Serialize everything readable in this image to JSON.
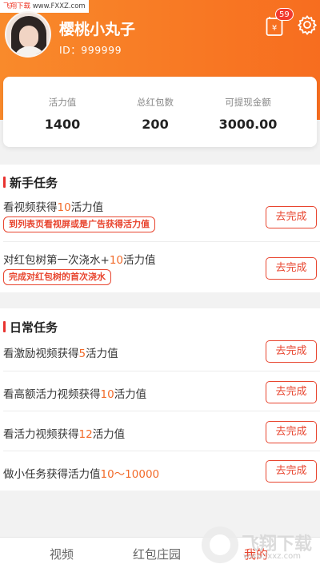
{
  "watermark": {
    "brand": "飞翔下载",
    "site": "www.FXXZ.com",
    "logo_text": "飞翔下载",
    "logo_url": "www.fxxz.com"
  },
  "profile": {
    "name": "樱桃小丸子",
    "id_label": "ID：999999"
  },
  "header": {
    "badge_count": "59"
  },
  "stats": [
    {
      "label": "活力值",
      "value": "1400"
    },
    {
      "label": "总红包数",
      "value": "200"
    },
    {
      "label": "可提现金额",
      "value": "3000.00"
    }
  ],
  "newbie": {
    "title": "新手任务",
    "tasks": [
      {
        "text_before": "看视频获得",
        "num": "10",
        "text_after": "活力值",
        "tag": "到列表页看视屏或是广告获得活力值",
        "button": "去完成"
      },
      {
        "text_before": "对红包树第一次浇水+",
        "num": "10",
        "text_after": "活力值",
        "tag": "完成对红包树的首次浇水",
        "button": "去完成"
      }
    ]
  },
  "daily": {
    "title": "日常任务",
    "tasks": [
      {
        "text_before": "看激励视频获得",
        "num": "5",
        "text_after": "活力值",
        "button": "去完成"
      },
      {
        "text_before": "看高额活力视频获得",
        "num": "10",
        "text_after": "活力值",
        "button": "去完成"
      },
      {
        "text_before": "看活力视频获得",
        "num": "12",
        "text_after": "活力值",
        "button": "去完成"
      },
      {
        "text_before": "做小任务获得活力值",
        "num": "10～10000",
        "text_after": "",
        "button": "去完成"
      }
    ]
  },
  "tabs": [
    {
      "label": "视频",
      "active": false
    },
    {
      "label": "红包庄园",
      "active": false
    },
    {
      "label": "我的",
      "active": true
    }
  ],
  "colors": {
    "accent": "#e8452f",
    "header_start": "#f98a2b",
    "header_end": "#f76d1f",
    "number": "#f26b2a"
  }
}
